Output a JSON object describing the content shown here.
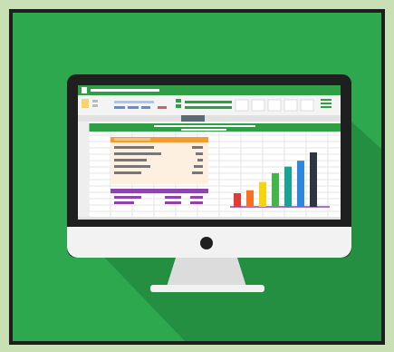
{
  "illustration": {
    "subject": "spreadsheet-monitor-icon",
    "palette": {
      "outer_background": "#c9e0b4",
      "tile_green": "#2ea84f",
      "shadow_green": "#208a3d",
      "monitor_body": "#1f1f1f",
      "monitor_chin": "#f2f2f2",
      "stand": "#d9d9d9",
      "sheet_green": "#2f9f45",
      "accent_orange": "#f39c35",
      "accent_purple": "#8e44ad",
      "accent_blue": "#5b8fd6",
      "accent_teal": "#2c8c79"
    },
    "icons": [
      "monitor-icon",
      "spreadsheet-icon",
      "bar-chart-icon"
    ]
  },
  "chart_data": {
    "type": "bar",
    "categories": [
      "",
      "",
      "",
      "",
      "",
      "",
      ""
    ],
    "values": [
      23,
      28,
      42,
      57,
      68,
      78,
      92
    ],
    "colors": [
      "#e53935",
      "#ff6f22",
      "#f5d40f",
      "#43b649",
      "#1aa392",
      "#2e86de",
      "#2f3542",
      "#7d3c98"
    ]
  }
}
